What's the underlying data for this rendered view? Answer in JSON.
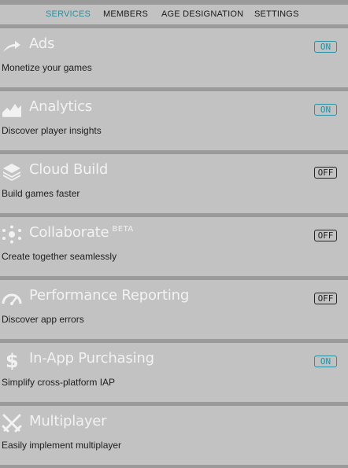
{
  "tabs": [
    {
      "label": "SERVICES",
      "active": true
    },
    {
      "label": "MEMBERS",
      "active": false
    },
    {
      "label": "AGE DESIGNATION",
      "active": false
    },
    {
      "label": "SETTINGS",
      "active": false
    }
  ],
  "services": [
    {
      "icon": "ads-arrow-icon",
      "title": "Ads",
      "beta": "",
      "description": "Monetize your games",
      "toggle": "ON"
    },
    {
      "icon": "analytics-chart-icon",
      "title": "Analytics",
      "beta": "",
      "description": "Discover player insights",
      "toggle": "ON"
    },
    {
      "icon": "cloud-build-layers-icon",
      "title": "Cloud Build",
      "beta": "",
      "description": "Build games faster",
      "toggle": "OFF"
    },
    {
      "icon": "collaborate-network-icon",
      "title": "Collaborate",
      "beta": "BETA",
      "description": "Create together seamlessly",
      "toggle": "OFF"
    },
    {
      "icon": "performance-gauge-icon",
      "title": "Performance Reporting",
      "beta": "",
      "description": "Discover app errors",
      "toggle": "OFF"
    },
    {
      "icon": "dollar-icon",
      "title": "In-App Purchasing",
      "beta": "",
      "description": "Simplify cross-platform IAP",
      "toggle": "ON"
    },
    {
      "icon": "multiplayer-swords-icon",
      "title": "Multiplayer",
      "beta": "",
      "description": "Easily implement multiplayer",
      "toggle": ""
    }
  ],
  "colors": {
    "accent": "#2a8fa0",
    "background": "#c2c2c2",
    "divider": "#9a9a9a"
  }
}
